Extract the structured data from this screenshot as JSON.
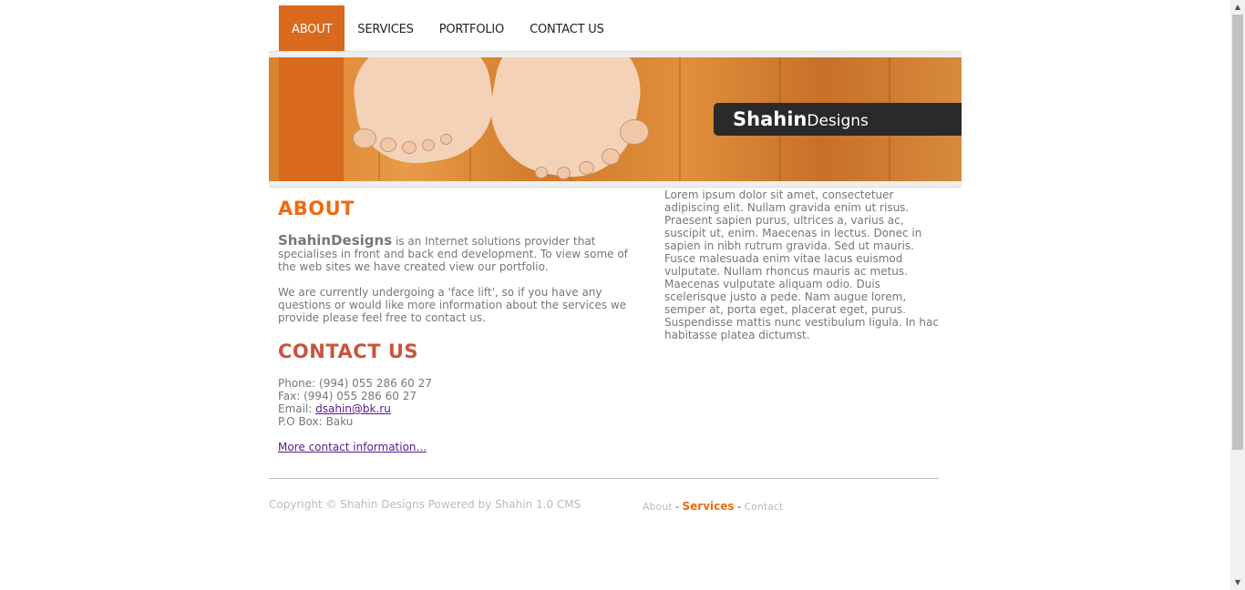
{
  "nav": {
    "items": [
      {
        "label": "ABOUT"
      },
      {
        "label": "SERVICES"
      },
      {
        "label": "PORTFOLIO"
      },
      {
        "label": "CONTACT US"
      }
    ],
    "active_index": 0
  },
  "banner": {
    "brand_bold": "Shahin",
    "brand_regular": "Designs"
  },
  "about": {
    "heading": "ABOUT",
    "brand_name": "ShahinDesigns",
    "intro_text": " is an Internet solutions provider that specialises in front and back end development. To view some of the web sites we have created view our portfolio.",
    "paragraph2": "We are currently undergoing a 'face lift', so if you have any questions or would like more information about the services we provide please feel free to contact us."
  },
  "contact": {
    "heading": "CONTACT US",
    "phone": "Phone: (994) 055 286 60 27",
    "fax": "Fax: (994) 055 286 60 27",
    "email_label": "Email: ",
    "email": "dsahin@bk.ru",
    "pobox": "P.O Box: Baku",
    "more_link": "More contact information..."
  },
  "sidebar": {
    "lorem": "Lorem ipsum dolor sit amet, consectetuer adipiscing elit. Nullam gravida enim ut risus. Praesent sapien purus, ultrices a, varius ac, suscipit ut, enim. Maecenas in lectus. Donec in sapien in nibh rutrum gravida. Sed ut mauris. Fusce malesuada enim vitae lacus euismod vulputate. Nullam rhoncus mauris ac metus. Maecenas vulputate aliquam odio. Duis scelerisque justo a pede. Nam augue lorem, semper at, porta eget, placerat eget, purus. Suspendisse mattis nunc vestibulum ligula. In hac habitasse platea dictumst."
  },
  "footer": {
    "copyright": "Copyright © Shahin Designs Powered by Shahin 1.0 CMS",
    "links": [
      {
        "label": "About"
      },
      {
        "label": "Services"
      },
      {
        "label": "Contact"
      }
    ],
    "separator": " - "
  },
  "colors": {
    "accent": "#d9691c",
    "heading_orange": "#ee6a10",
    "heading_red": "#c8553d"
  }
}
